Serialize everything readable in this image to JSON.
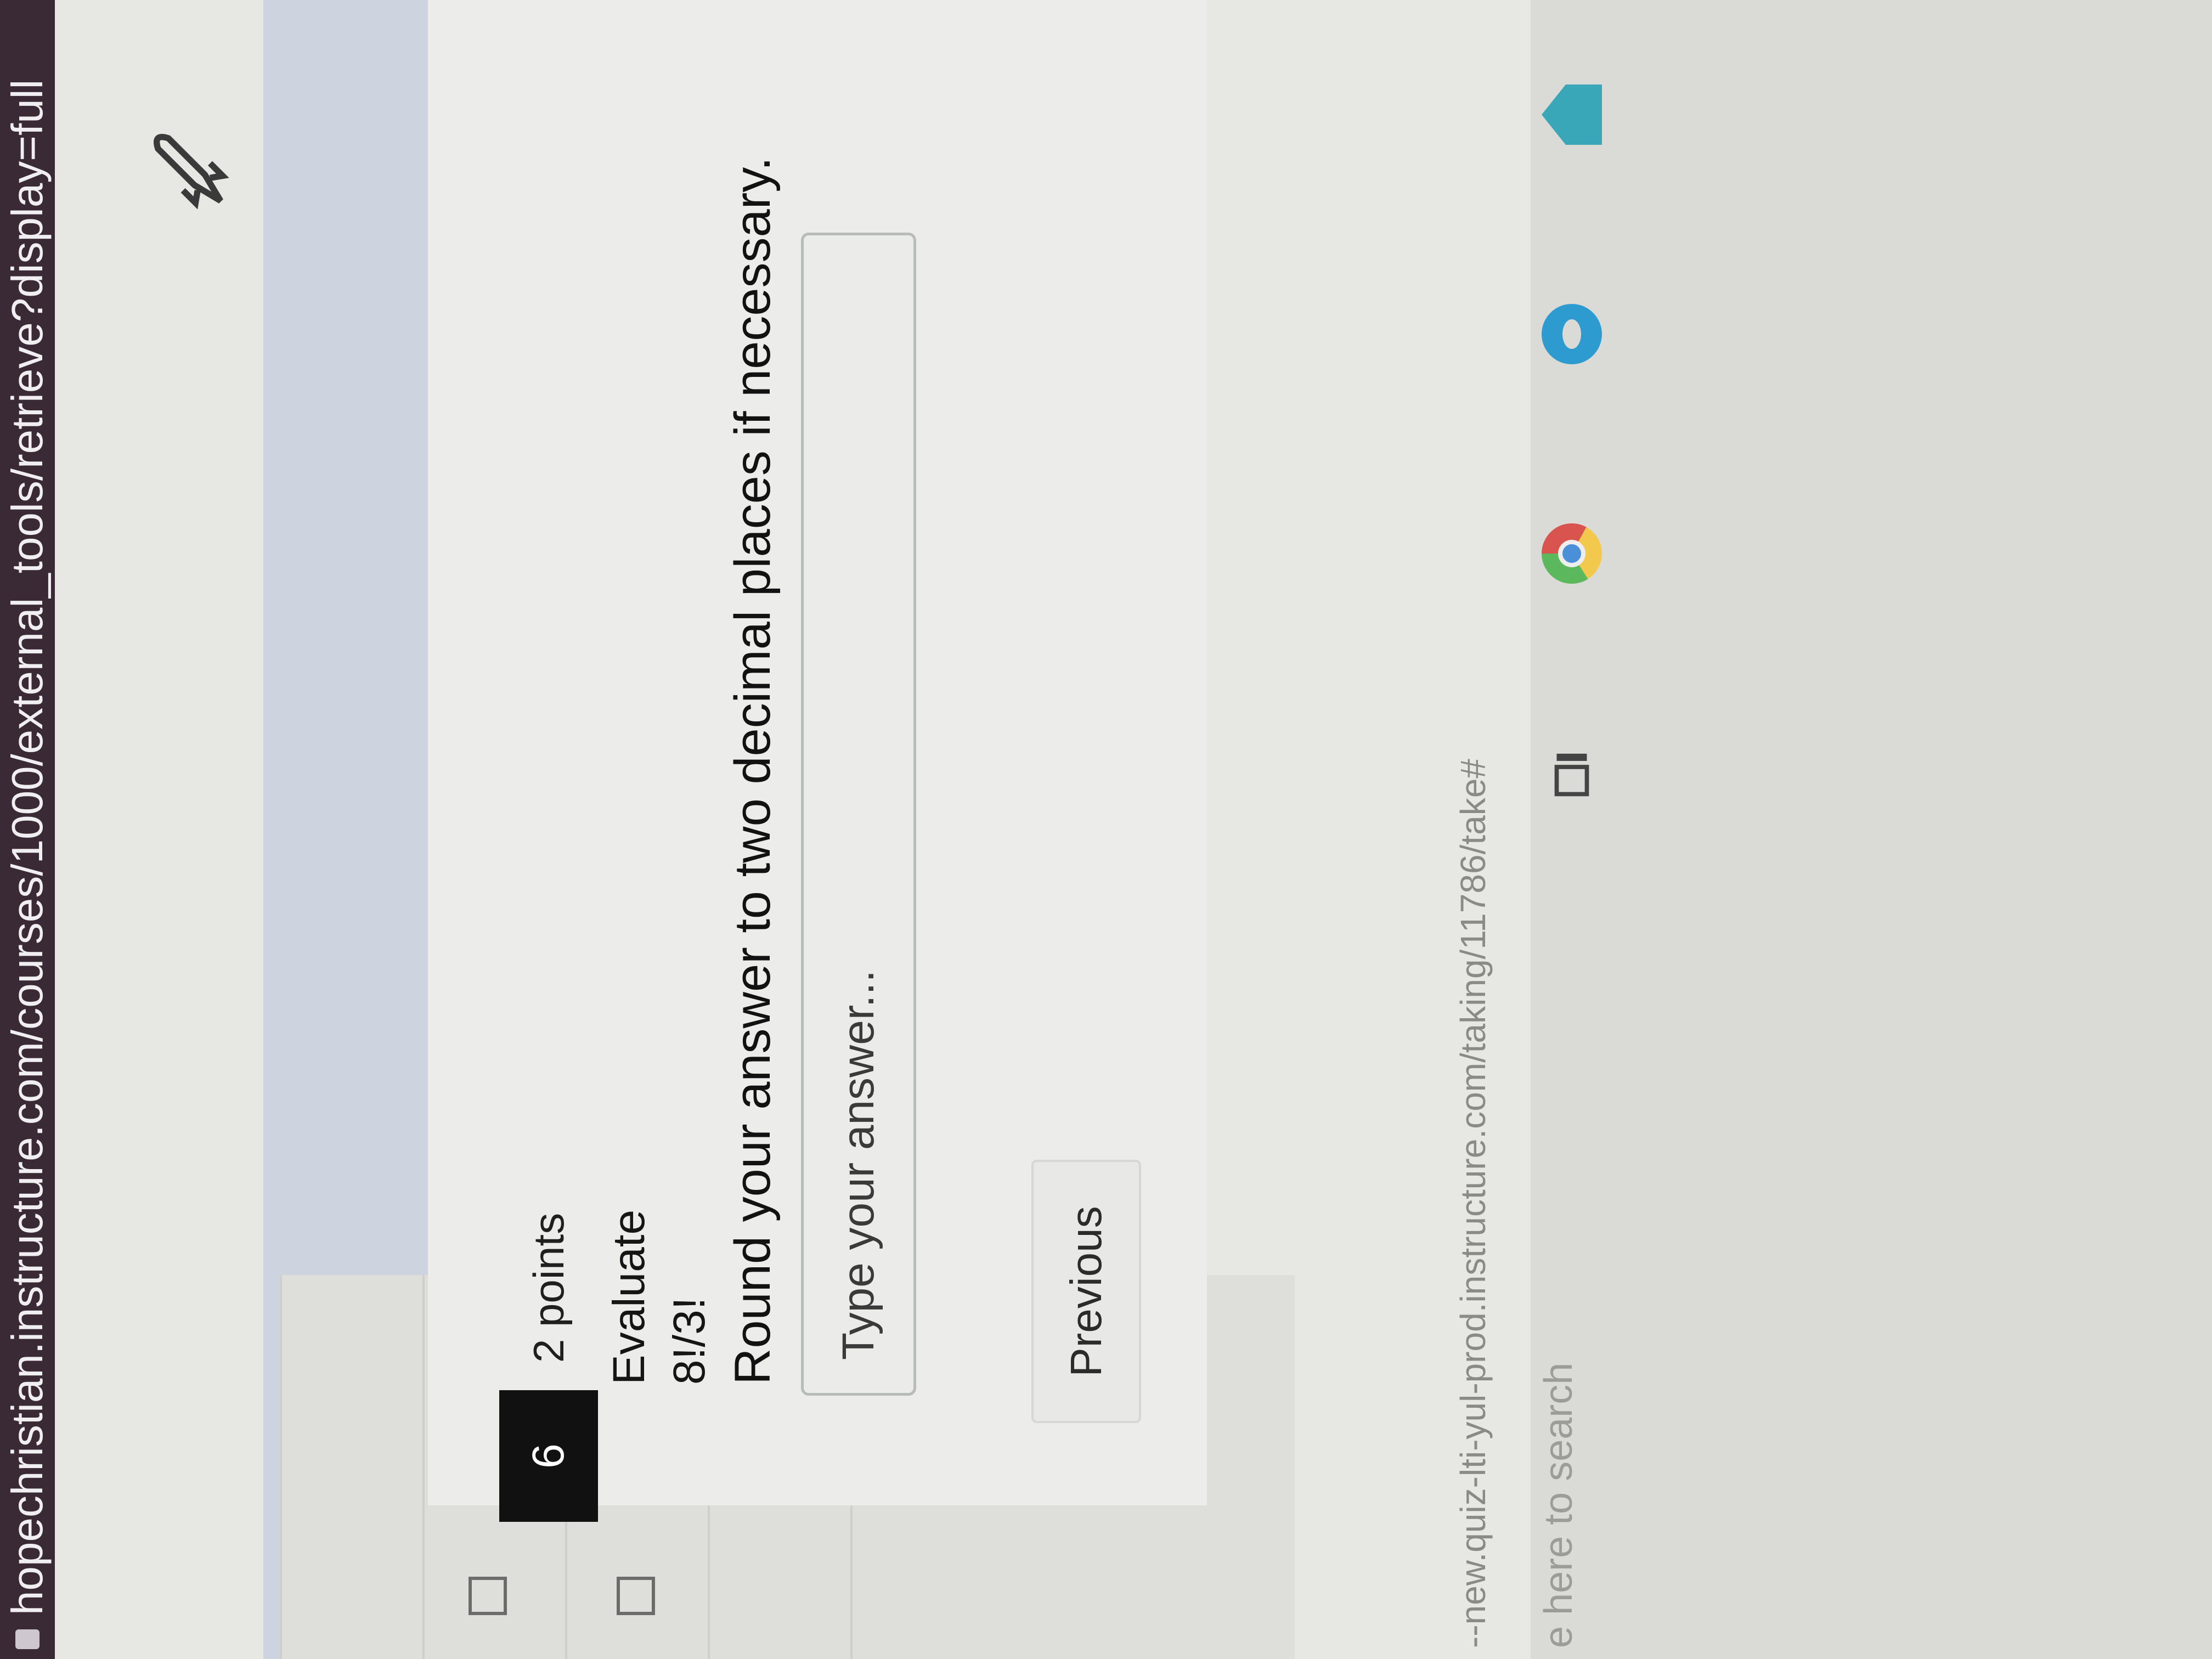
{
  "browser": {
    "address": "hopechristian.instructure.com/courses/1000/external_tools/retrieve?display=full"
  },
  "question": {
    "number": "6",
    "points": "2 points",
    "prompt": "Evaluate",
    "expression": "8!/3!",
    "instruction": "Round your answer to two decimal places if necessary."
  },
  "answer": {
    "placeholder": "Type your answer..."
  },
  "navigation": {
    "previous_label": "Previous"
  },
  "status_bar": {
    "url": "--new.quiz-lti-yul-prod.instructure.com/taking/11786/take#"
  },
  "taskbar": {
    "search_hint": "e here to search"
  },
  "icons": {
    "lock": "lock-icon",
    "rocket": "rocket-icon",
    "task_view": "task-view-icon",
    "chrome": "chrome-icon",
    "edge": "edge-icon"
  }
}
